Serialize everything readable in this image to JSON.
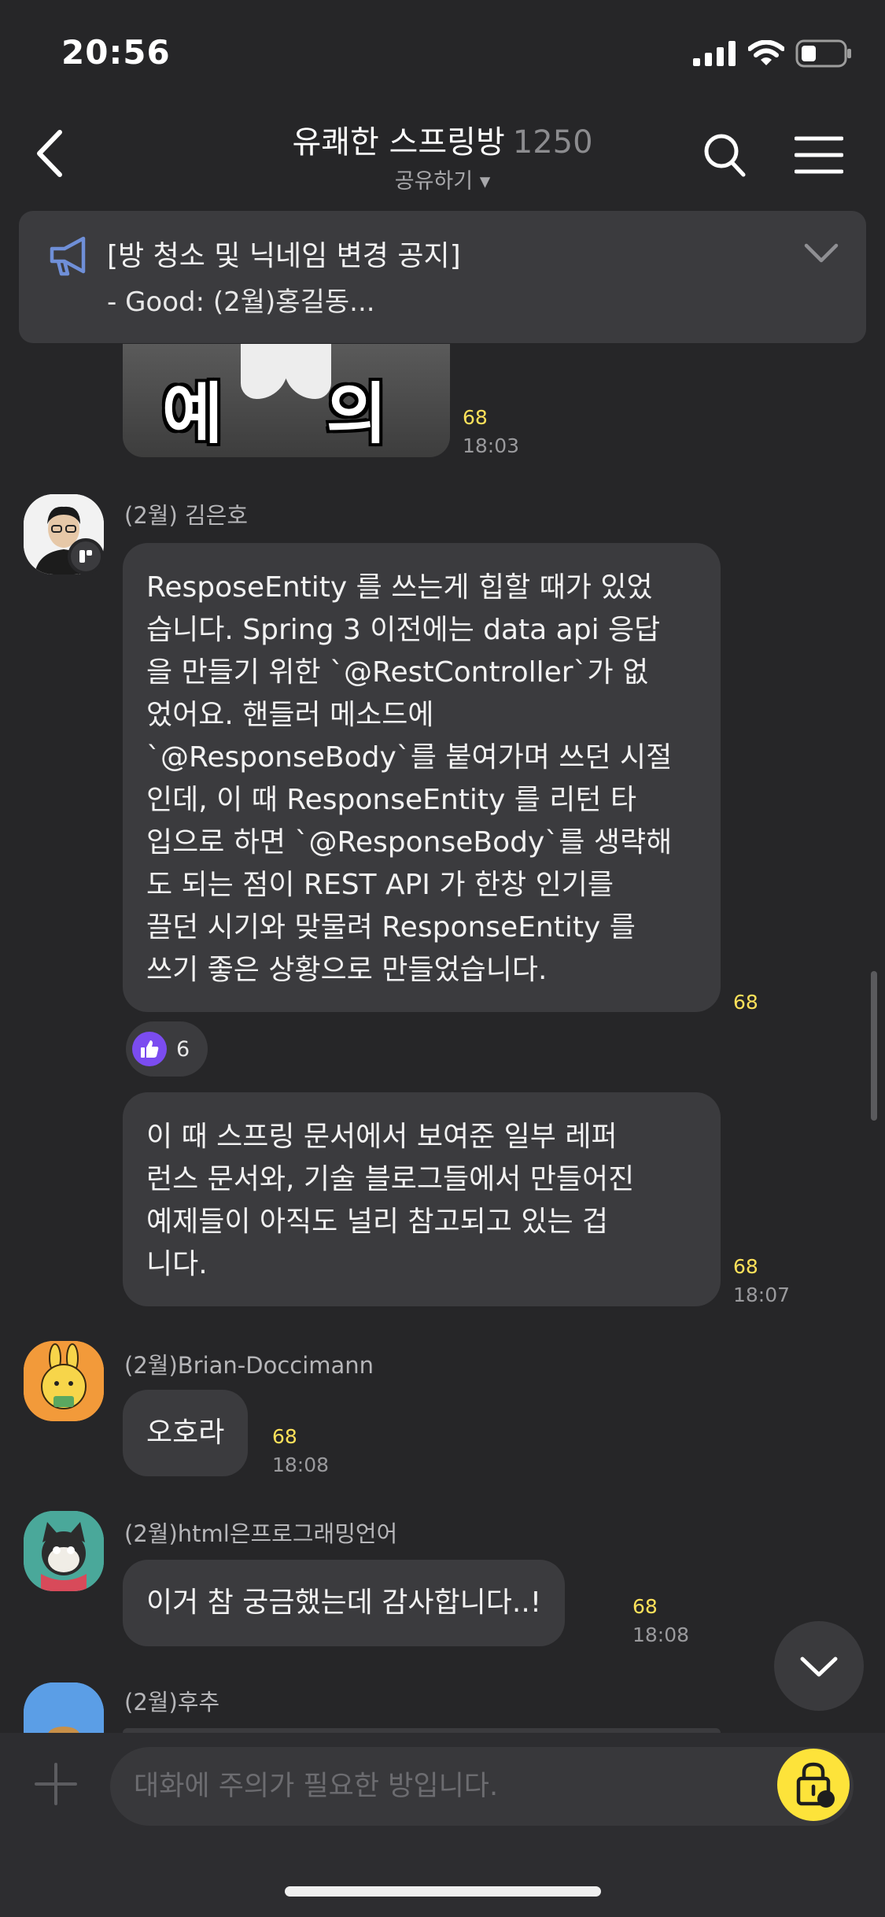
{
  "status_bar": {
    "time": "20:56"
  },
  "header": {
    "title": "유쾌한 스프링방",
    "member_count": "1250",
    "share_label": "공유하기 ▾"
  },
  "notice": {
    "title": "[방 청소 및 닉네임 변경 공지]",
    "subtitle": "- Good: (2월)홍길동..."
  },
  "image_message": {
    "caption_left": "예",
    "caption_right": "의",
    "unread": "68",
    "time": "18:03"
  },
  "messages": [
    {
      "sender": "(2월) 김은호",
      "bubbles": [
        {
          "lines": [
            "ResposeEntity 를 쓰는게 힙할 때가 있었",
            "습니다. Spring 3 이전에는 data api 응답",
            "을 만들기 위한 `@RestController`가 없",
            "었어요. 핸들러 메소드에",
            "`@ResponseBody`를 붙여가며 쓰던 시절",
            "인데, 이 때 ResponseEntity 를 리턴 타",
            "입으로 하면 `@ResponseBody`를 생략해",
            "도 되는 점이 REST API 가 한창 인기를",
            "끌던 시기와 맞물려 ResponseEntity 를",
            "쓰기 좋은 상황으로 만들었습니다."
          ],
          "unread": "68",
          "time": "",
          "reaction_count": "6"
        },
        {
          "lines": [
            "이 때 스프링 문서에서 보여준 일부 레퍼",
            "런스 문서와, 기술 블로그들에서 만들어진",
            "예제들이 아직도 널리 참고되고 있는 겁",
            "니다."
          ],
          "unread": "68",
          "time": "18:07"
        }
      ]
    },
    {
      "sender": "(2월)Brian-Doccimann",
      "text": "오호라",
      "unread": "68",
      "time": "18:08"
    },
    {
      "sender": "(2월)html은프로그래밍언어",
      "text": "이거 참 궁금했는데 감사합니다..!",
      "unread": "68",
      "time": "18:08"
    },
    {
      "sender": "(2월)후추"
    }
  ],
  "input": {
    "placeholder": "대화에 주의가 필요한 방입니다."
  },
  "colors": {
    "background": "#262628",
    "bubble": "#3b3b3e",
    "unread": "#ffe15a",
    "reaction": "#7b4cf0",
    "lock_button": "#fde33a"
  }
}
